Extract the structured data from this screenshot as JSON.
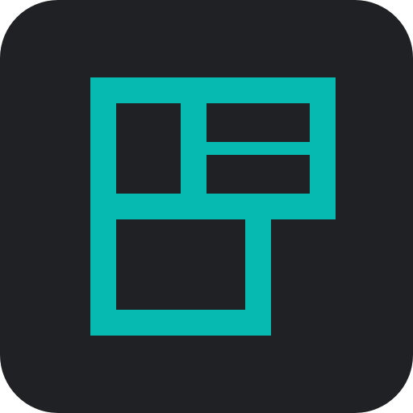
{
  "app_icon": {
    "icon_name": "layout-grid-icon",
    "background_color": "#202125",
    "glyph_color": "#06B9B1"
  }
}
